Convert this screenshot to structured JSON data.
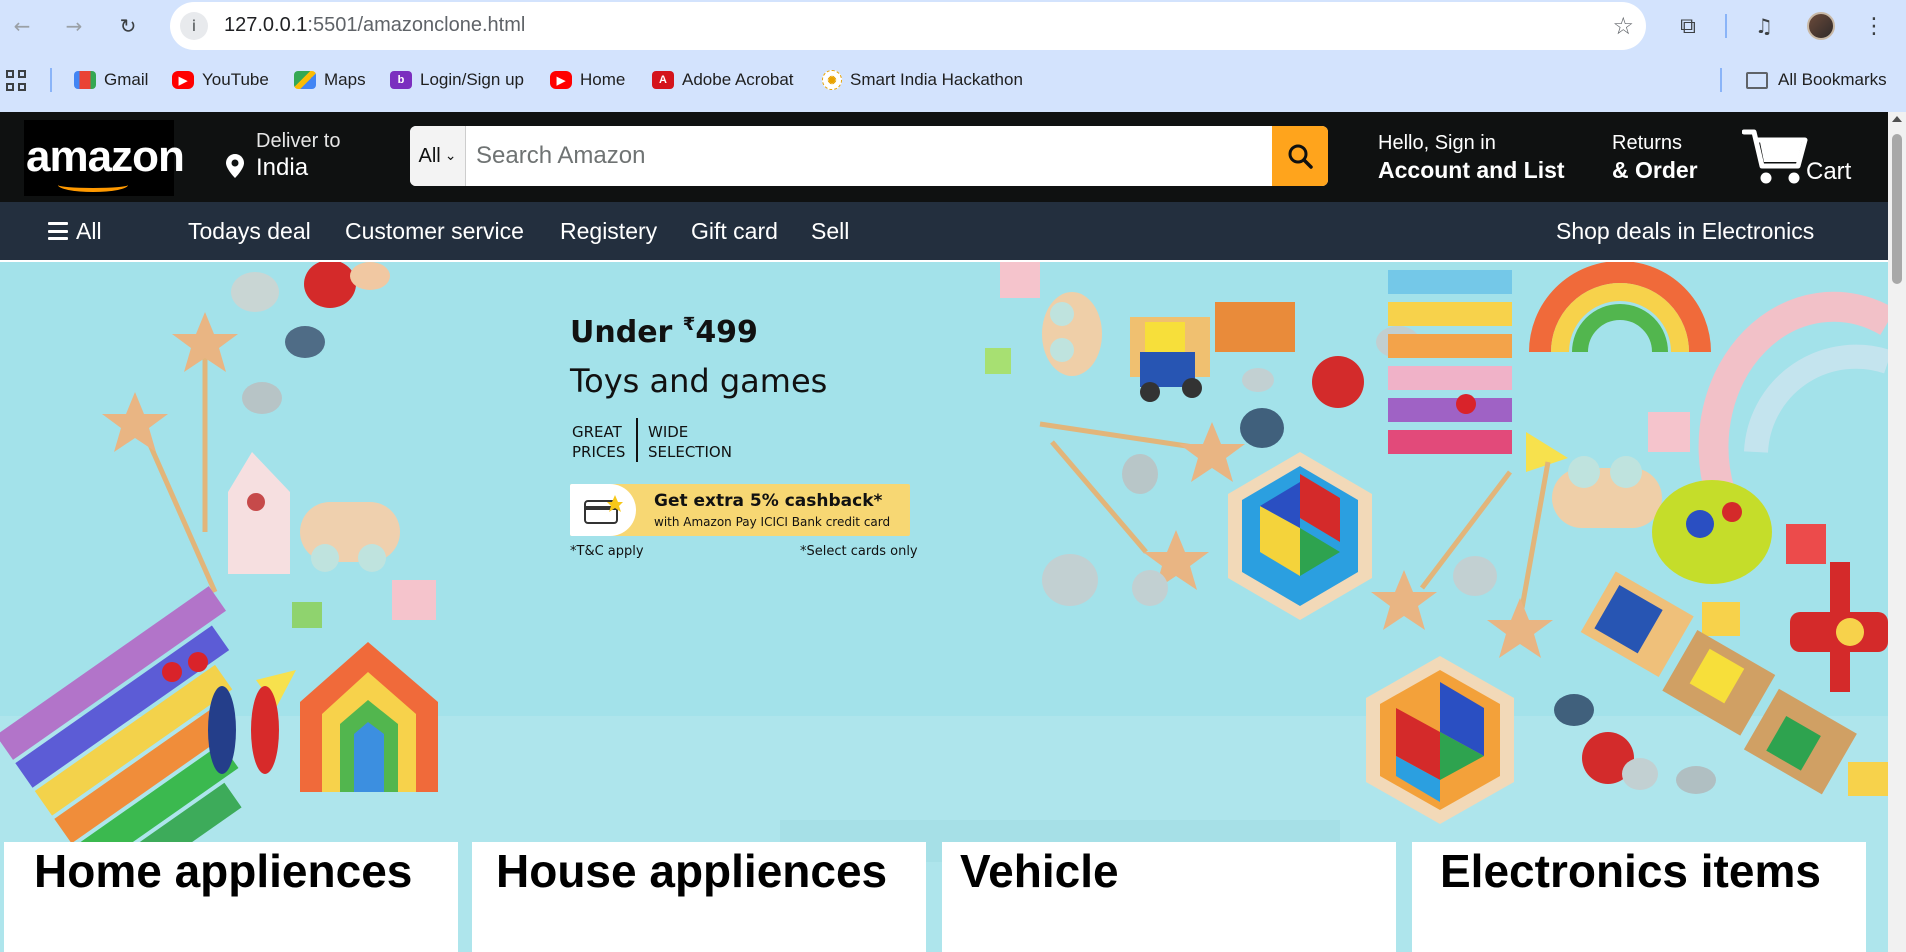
{
  "browser": {
    "url_host": "127.0.0.1",
    "url_path": ":5501/amazonclone.html",
    "bookmarks": [
      {
        "label": "Gmail",
        "icon": "gmail-icon"
      },
      {
        "label": "YouTube",
        "icon": "youtube-icon"
      },
      {
        "label": "Maps",
        "icon": "maps-icon"
      },
      {
        "label": "Login/Sign up",
        "icon": "login-icon"
      },
      {
        "label": "Home",
        "icon": "youtube-icon"
      },
      {
        "label": "Adobe Acrobat",
        "icon": "acrobat-icon"
      },
      {
        "label": "Smart India Hackathon",
        "icon": "sih-icon"
      }
    ],
    "all_bookmarks": "All Bookmarks"
  },
  "header": {
    "logo_text": "amazon",
    "deliver_line1": "Deliver to",
    "deliver_line2": "India",
    "search_category": "All",
    "search_placeholder": "Search Amazon",
    "signin_line1": "Hello, Sign in",
    "signin_line2": "Account and List",
    "returns_line1": "Returns",
    "returns_line2": "& Order",
    "cart_label": "Cart"
  },
  "subnav": {
    "all": "All",
    "items": [
      "Todays deal",
      "Customer service",
      "Registery",
      "Gift card",
      "Sell"
    ],
    "right": "Shop deals in Electronics"
  },
  "hero": {
    "title_prefix": "Under ",
    "currency": "₹",
    "price": "499",
    "subtitle": "Toys and games",
    "badge_left_1": "GREAT",
    "badge_left_2": "PRICES",
    "badge_right_1": "WIDE",
    "badge_right_2": "SELECTION",
    "cashback_line1": "Get extra 5% cashback*",
    "cashback_line2": "with Amazon Pay ICICI Bank credit card",
    "tc": "*T&C apply",
    "select_cards": "*Select cards only"
  },
  "cards": [
    {
      "title": "Home appliences"
    },
    {
      "title": "House appliences"
    },
    {
      "title": "Vehicle"
    },
    {
      "title": "Electronics items"
    }
  ],
  "colors": {
    "amazon_header": "#0f1111",
    "subnav": "#232f3e",
    "search_button": "#ffa41c",
    "hero_bg": "#a3e2ea",
    "logo_smile": "#ff9900"
  }
}
